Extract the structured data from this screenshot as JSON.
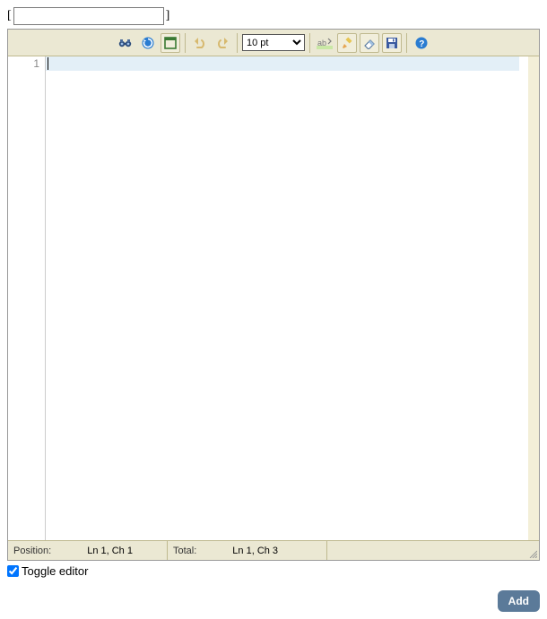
{
  "title_input": {
    "value": ""
  },
  "toolbar": {
    "font_size_selected": "10 pt"
  },
  "gutter": {
    "line1": "1"
  },
  "statusbar": {
    "position_label": "Position:",
    "position_value": "Ln 1, Ch 1",
    "total_label": "Total:",
    "total_value": "Ln 1, Ch 3"
  },
  "toggle": {
    "label": "Toggle editor",
    "checked": true
  },
  "buttons": {
    "add": "Add"
  }
}
